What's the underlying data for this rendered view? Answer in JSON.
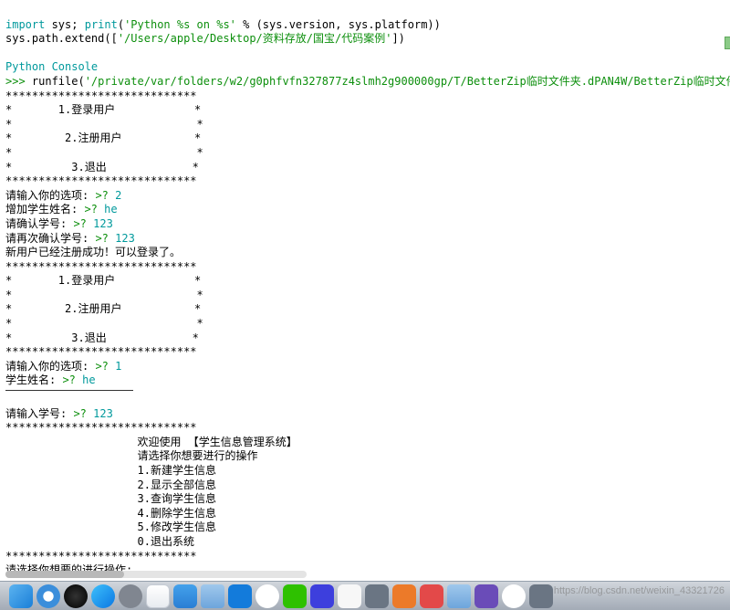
{
  "header": {
    "line1_a": "import",
    "line1_b": " sys; ",
    "line1_c": "print",
    "line1_d": "(",
    "line1_e": "'Python %s on %s'",
    "line1_f": " % (sys.version, sys.platform))",
    "line2_a": "sys.path.extend([",
    "line2_b": "'/Users/apple/Desktop/资料存放/国宝/代码案例'",
    "line2_c": "])"
  },
  "console_label": "Python Console",
  "prompt": ">>> ",
  "runfile_a": "runfile(",
  "runfile_b": "'/private/var/folders/w2/g0phfvfn327877z4slmh2g900000gp/T/BetterZip临时文件夹.dPAN4W/BetterZip临时文件夹.mS;",
  "menu1": {
    "sep": "*****************************",
    "row1": "*       1.登录用户            *",
    "row_blank": "*                            *",
    "row2": "*        2.注册用户           *",
    "row3": "*         3.退出             *"
  },
  "inputs": {
    "choice_label": "请输入你的选项: ",
    "q": ">? ",
    "choice1": "2",
    "add_name_label": "增加学生姓名: ",
    "name1": "he",
    "confirm_id_label": "请确认学号: ",
    "id1": "123",
    "reconfirm_label": "请再次确认学号: ",
    "id2": "123",
    "success": "新用户已经注册成功！可以登录了。",
    "choice2": "1",
    "name_label": "学生姓名: ",
    "name2": "he",
    "enter_id_label": "请输入学号: ",
    "id3": "123"
  },
  "sysmenu": {
    "sep": "*****************************",
    "title": "                    欢迎使用 【学生信息管理系统】",
    "subtitle": "                    请选择你想要进行的操作",
    "m1": "                    1.新建学生信息",
    "m2": "                    2.显示全部信息",
    "m3": "                    3.查询学生信息",
    "m4": "                    4.删除学生信息",
    "m5": "                    5.修改学生信息",
    "m0": "                    0.退出系统"
  },
  "final_prompt": "请选择你想要的进行操作:",
  "final_q": ">?",
  "watermark": "https://blog.csdn.net/weixin_43321726"
}
